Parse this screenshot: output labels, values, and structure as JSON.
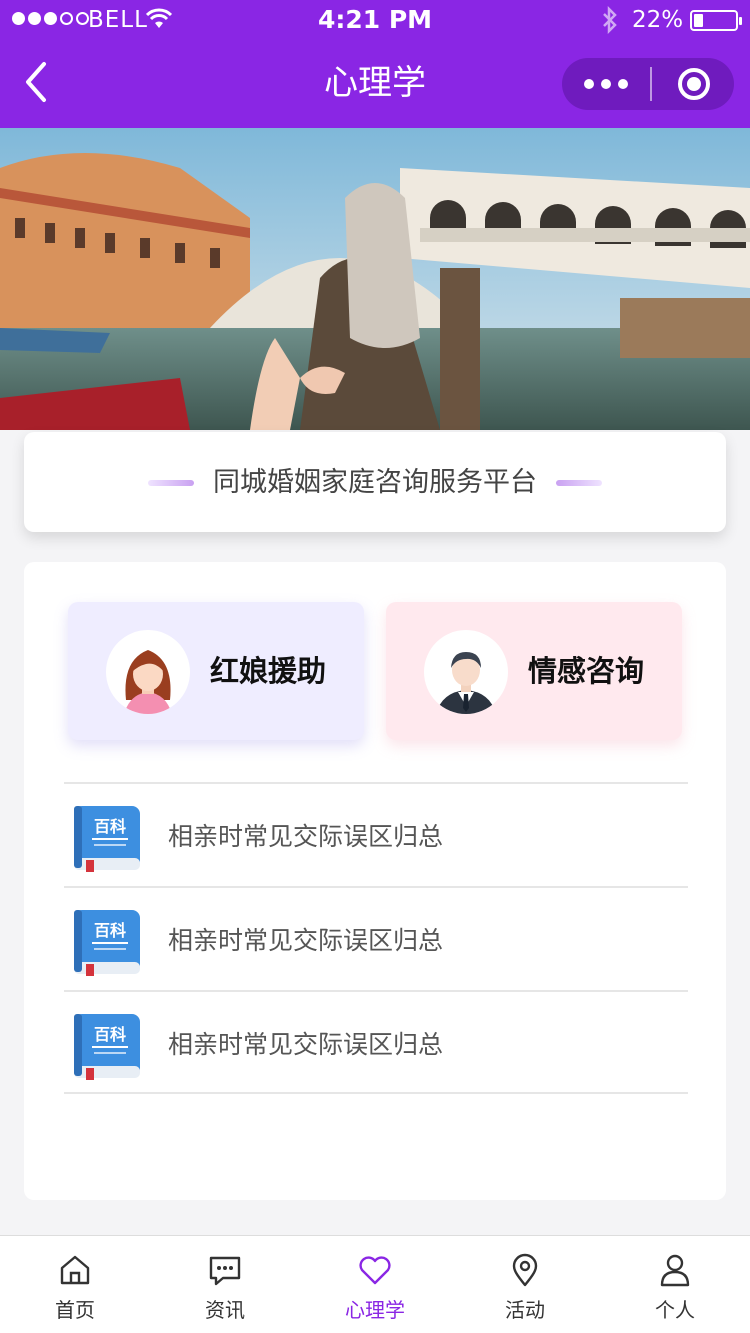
{
  "status_bar": {
    "carrier": "BELL",
    "time": "4:21 PM",
    "battery_percent_text": "22%",
    "battery_level": 0.22
  },
  "nav": {
    "title": "心理学",
    "back_icon": "chevron-left-icon",
    "more_icon": "more-dots-icon",
    "close_icon": "target-circle-icon"
  },
  "banner": {
    "image": "venice-rialto-bridge-follow-me-photo"
  },
  "slogan": {
    "text": "同城婚姻家庭咨询服务平台"
  },
  "services": [
    {
      "label": "红娘援助",
      "icon": "woman-avatar-icon"
    },
    {
      "label": "情感咨询",
      "icon": "man-avatar-icon"
    }
  ],
  "articles": [
    {
      "title": "相亲时常见交际误区归总",
      "icon": "encyclopedia-book-icon",
      "icon_text": "百科"
    },
    {
      "title": "相亲时常见交际误区归总",
      "icon": "encyclopedia-book-icon",
      "icon_text": "百科"
    },
    {
      "title": "相亲时常见交际误区归总",
      "icon": "encyclopedia-book-icon",
      "icon_text": "百科"
    }
  ],
  "tabbar": {
    "items": [
      {
        "label": "首页",
        "icon": "home-icon",
        "active": false
      },
      {
        "label": "资讯",
        "icon": "chat-bubble-icon",
        "active": false
      },
      {
        "label": "心理学",
        "icon": "heart-icon",
        "active": true
      },
      {
        "label": "活动",
        "icon": "location-pin-icon",
        "active": false
      },
      {
        "label": "个人",
        "icon": "person-icon",
        "active": false
      }
    ]
  },
  "colors": {
    "brand": "#8a26e4",
    "matchmaker_bg": "#efedff",
    "counsel_bg": "#ffe9ee"
  }
}
